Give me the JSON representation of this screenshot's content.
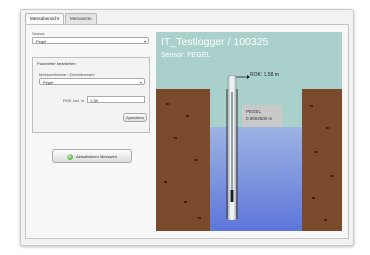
{
  "tabs": [
    {
      "label": "Messübersicht"
    },
    {
      "label": "Messwerte"
    }
  ],
  "form": {
    "sensor_label": "Sensor",
    "sensor_value": "Pegel",
    "group_title": "Parameter bearbeiten",
    "param_label": "Messwertname / Einheitenwahl",
    "param_value": "Pegel",
    "input_label": "ROK incl. in",
    "input_value": "1.38",
    "save_button": "Speichern",
    "refresh_button": "Aktualisieren Messwert"
  },
  "visualization": {
    "title": "IT_Testlogger / 100325",
    "sensor_line": "Sensor: PEGEL",
    "rok_label": "ROK: 1.58 m",
    "pegel_title": "PEGEL",
    "pegel_value": "0.0002600 m",
    "colors": {
      "sky": "#a9d0ca",
      "water_top": "#9eb3e4",
      "water_bottom": "#5d76d9",
      "soil": "#7a4a2c"
    }
  },
  "icons": {
    "refresh_button_icon": "green-circle-icon",
    "select_arrow": "chevron-down-icon",
    "rok_arrow": "arrow-right-icon"
  }
}
